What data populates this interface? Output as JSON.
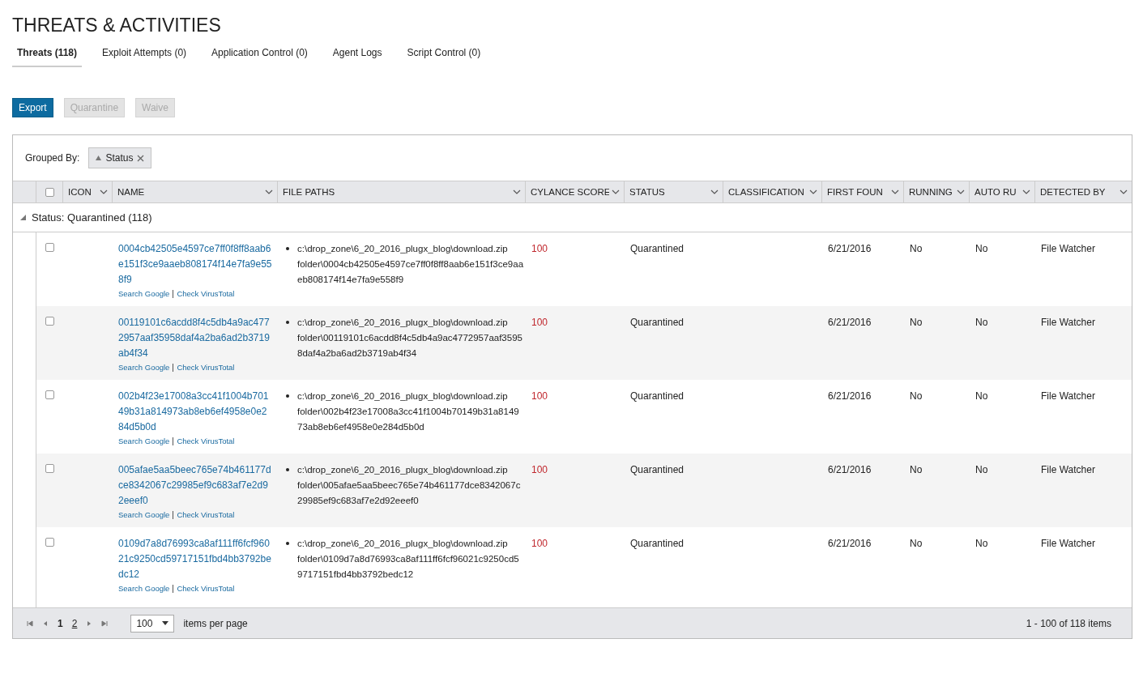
{
  "page_title": "THREATS & ACTIVITIES",
  "tabs": [
    {
      "label": "Threats (118)",
      "selected": true
    },
    {
      "label": "Exploit Attempts (0)",
      "selected": false
    },
    {
      "label": "Application Control (0)",
      "selected": false
    },
    {
      "label": "Agent Logs",
      "selected": false
    },
    {
      "label": "Script Control (0)",
      "selected": false
    }
  ],
  "actions": [
    {
      "label": "Export",
      "disabled": false
    },
    {
      "label": "Quarantine",
      "disabled": true
    },
    {
      "label": "Waive",
      "disabled": true
    }
  ],
  "grouping": {
    "label": "Grouped By:",
    "chip": "Status"
  },
  "table": {
    "select_all": {
      "checked": false
    },
    "columns": [
      "ICON",
      "NAME",
      "FILE PATHS",
      "CYLANCE SCORE",
      "STATUS",
      "CLASSIFICATION",
      "FIRST FOUN",
      "RUNNING",
      "AUTO RU",
      "DETECTED BY"
    ],
    "group": {
      "label": "Status: Quarantined (118)",
      "expanded": true
    },
    "rows": [
      {
        "checked": false,
        "name": "0004cb42505e4597ce7ff0f8ff8aab6e151f3ce9aaeb808174f14e7fa9e558f9",
        "links": [
          "Search Google",
          "Check VirusTotal"
        ],
        "file_path": "c:\\drop_zone\\6_20_2016_plugx_blog\\download.zip folder\\0004cb42505e4597ce7ff0f8ff8aab6e151f3ce9aaeb808174f14e7fa9e558f9",
        "score": "100",
        "status": "Quarantined",
        "first_found": "6/21/2016",
        "running": "No",
        "auto_run": "No",
        "detected_by": "File Watcher"
      },
      {
        "checked": false,
        "name": "00119101c6acdd8f4c5db4a9ac4772957aaf35958daf4a2ba6ad2b3719ab4f34",
        "links": [
          "Search Google",
          "Check VirusTotal"
        ],
        "file_path": "c:\\drop_zone\\6_20_2016_plugx_blog\\download.zip folder\\00119101c6acdd8f4c5db4a9ac4772957aaf35958daf4a2ba6ad2b3719ab4f34",
        "score": "100",
        "status": "Quarantined",
        "first_found": "6/21/2016",
        "running": "No",
        "auto_run": "No",
        "detected_by": "File Watcher"
      },
      {
        "checked": false,
        "name": "002b4f23e17008a3cc41f1004b70149b31a814973ab8eb6ef4958e0e284d5b0d",
        "links": [
          "Search Google",
          "Check VirusTotal"
        ],
        "file_path": "c:\\drop_zone\\6_20_2016_plugx_blog\\download.zip folder\\002b4f23e17008a3cc41f1004b70149b31a814973ab8eb6ef4958e0e284d5b0d",
        "score": "100",
        "status": "Quarantined",
        "first_found": "6/21/2016",
        "running": "No",
        "auto_run": "No",
        "detected_by": "File Watcher"
      },
      {
        "checked": false,
        "name": "005afae5aa5beec765e74b461177dce8342067c29985ef9c683af7e2d92eeef0",
        "links": [
          "Search Google",
          "Check VirusTotal"
        ],
        "file_path": "c:\\drop_zone\\6_20_2016_plugx_blog\\download.zip folder\\005afae5aa5beec765e74b461177dce8342067c29985ef9c683af7e2d92eeef0",
        "score": "100",
        "status": "Quarantined",
        "first_found": "6/21/2016",
        "running": "No",
        "auto_run": "No",
        "detected_by": "File Watcher"
      },
      {
        "checked": false,
        "name": "0109d7a8d76993ca8af111ff6fcf96021c9250cd59717151fbd4bb3792bedc12",
        "links": [
          "Search Google",
          "Check VirusTotal"
        ],
        "file_path": "c:\\drop_zone\\6_20_2016_plugx_blog\\download.zip folder\\0109d7a8d76993ca8af111ff6fcf96021c9250cd59717151fbd4bb3792bedc12",
        "score": "100",
        "status": "Quarantined",
        "first_found": "6/21/2016",
        "running": "No",
        "auto_run": "No",
        "detected_by": "File Watcher"
      }
    ]
  },
  "pager": {
    "pages": [
      {
        "label": "1",
        "selected": true
      },
      {
        "label": "2",
        "selected": false
      }
    ],
    "page_size": "100",
    "page_size_label": "items per page",
    "summary": "1 - 100 of 118 items"
  }
}
